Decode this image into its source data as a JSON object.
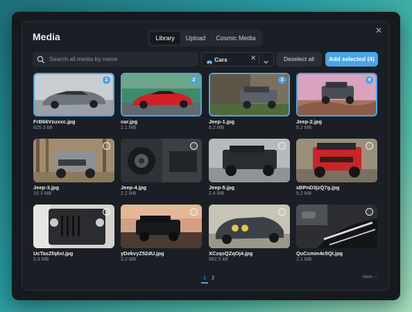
{
  "modal": {
    "title": "Media",
    "close_icon": "close-icon"
  },
  "tabs": [
    {
      "label": "Library",
      "active": true
    },
    {
      "label": "Upload",
      "active": false
    },
    {
      "label": "Cosmic Media",
      "active": false
    }
  ],
  "search": {
    "placeholder": "Search all media by name",
    "icon": "search-icon"
  },
  "filter": {
    "value": "Cars",
    "clear_icon": "close-icon",
    "chevron_icon": "chevron-down-icon"
  },
  "actions": {
    "deselect_label": "Deselect all",
    "add_selected_label": "Add selected (4)"
  },
  "colors": {
    "accent": "#47a6e8",
    "modal_bg": "#161a1f",
    "panel_bg": "#1b1f25"
  },
  "media": [
    {
      "name": "FrB66Vzuxxc.jpg",
      "size": "825.3 kB",
      "selected": true,
      "order": "1",
      "subject": "silver sports car"
    },
    {
      "name": "car.jpg",
      "size": "2.1 MB",
      "selected": true,
      "order": "2",
      "subject": "red sports car"
    },
    {
      "name": "Jeep-1.jpg",
      "size": "8.2 MB",
      "selected": true,
      "order": "3",
      "subject": "gray jeep near cliff"
    },
    {
      "name": "Jeep-2.jpg",
      "size": "5.2 MB",
      "selected": true,
      "order": "4",
      "subject": "jeep on rocks"
    },
    {
      "name": "Jeep-3.jpg",
      "size": "10.3 MB",
      "selected": false,
      "order": "",
      "subject": "jeep in forest"
    },
    {
      "name": "Jeep-4.jpg",
      "size": "2.2 MB",
      "selected": false,
      "order": "",
      "subject": "jeep spare tire"
    },
    {
      "name": "Jeep-5.jpg",
      "size": "2.4 MB",
      "selected": false,
      "order": "",
      "subject": "black jeep"
    },
    {
      "name": "sBPnD3jzQ7g.jpg",
      "size": "5.2 MB",
      "selected": false,
      "order": "",
      "subject": "red jeep"
    },
    {
      "name": "UcTasZfq6xI.jpg",
      "size": "5.3 MB",
      "selected": false,
      "order": "",
      "subject": "jeep grille"
    },
    {
      "name": "yDekvyZ52dU.jpg",
      "size": "3.2 MB",
      "selected": false,
      "order": "",
      "subject": "jeep at sunset"
    },
    {
      "name": "XCzqsQZqOj4.jpg",
      "size": "992.5 kB",
      "selected": false,
      "order": "",
      "subject": "rally car"
    },
    {
      "name": "QuCcmm4c5QI.jpg",
      "size": "1.1 MB",
      "selected": false,
      "order": "",
      "subject": "classic car closeup"
    }
  ],
  "pagination": {
    "pages": [
      "1",
      "2"
    ],
    "current": "1",
    "next_label": "Next →"
  }
}
